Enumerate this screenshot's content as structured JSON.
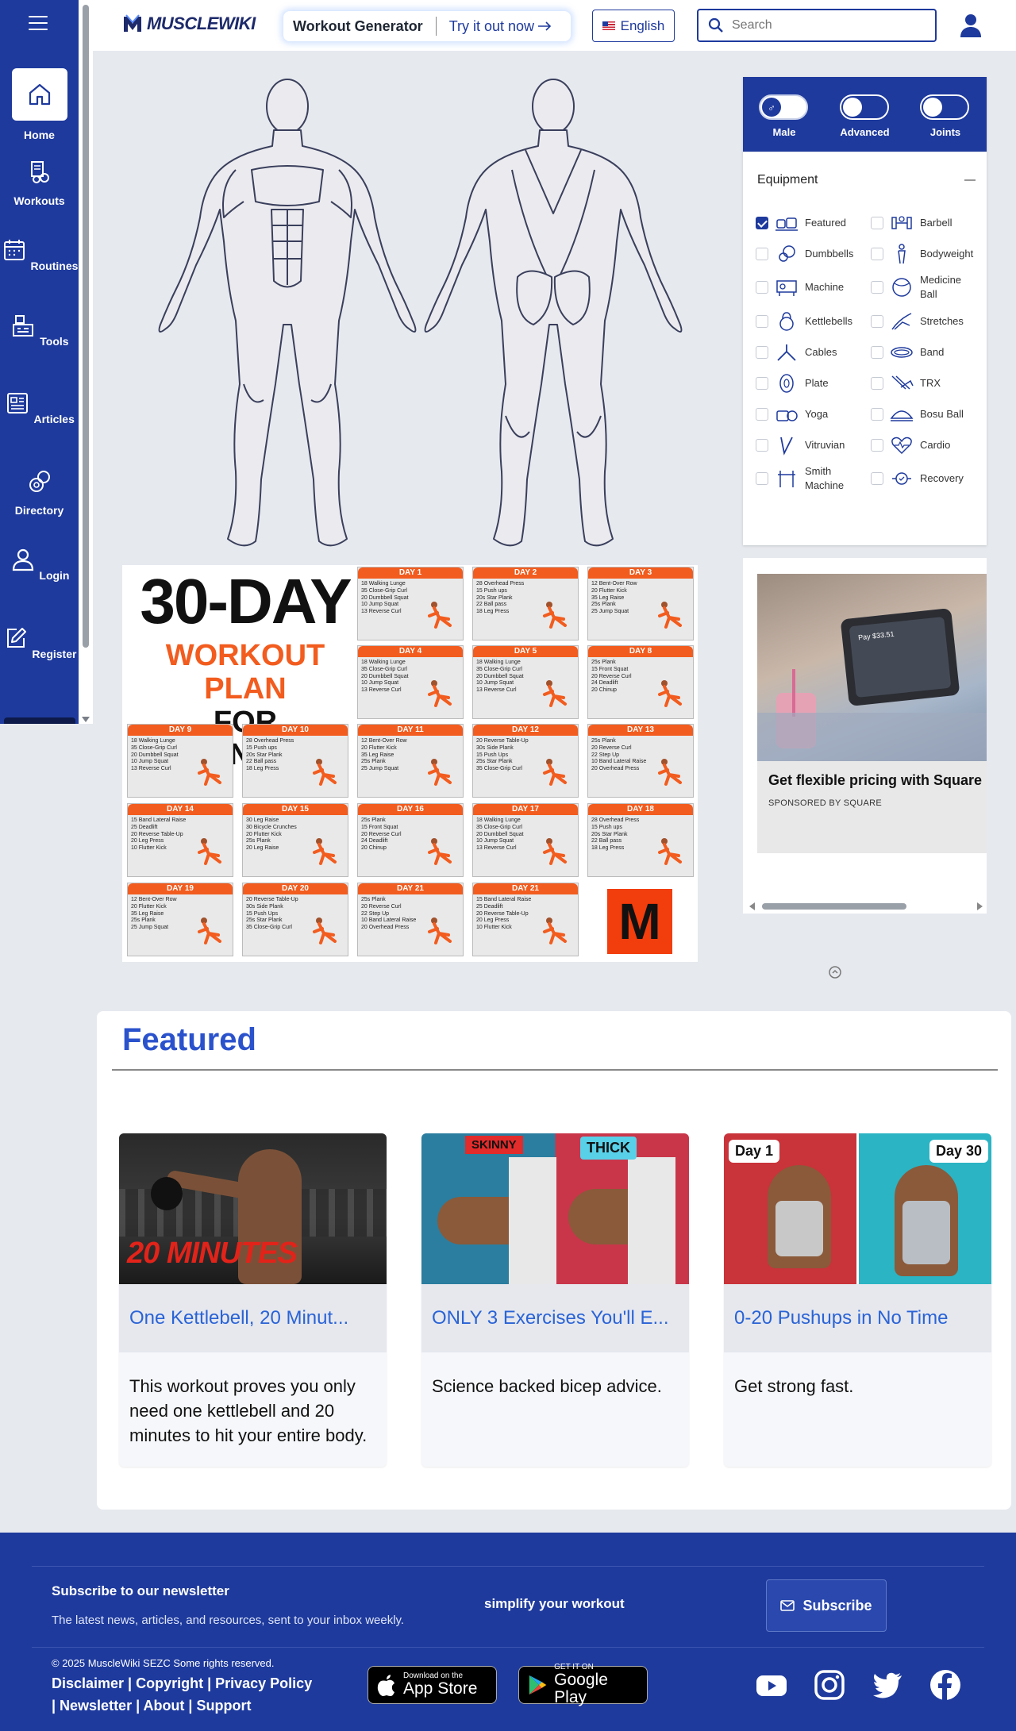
{
  "brand": {
    "name": "MUSCLEWIKI"
  },
  "sidebar": {
    "items": [
      {
        "label": "Home",
        "icon": "home-icon",
        "active": true
      },
      {
        "label": "Workouts",
        "icon": "workouts-icon"
      },
      {
        "label": "Routines",
        "icon": "calendar-icon"
      },
      {
        "label": "Tools",
        "icon": "tools-icon"
      },
      {
        "label": "Articles",
        "icon": "articles-icon"
      },
      {
        "label": "Directory",
        "icon": "directory-icon"
      },
      {
        "label": "Login",
        "icon": "user-icon"
      },
      {
        "label": "Register",
        "icon": "edit-icon"
      }
    ]
  },
  "header": {
    "workout_generator": "Workout Generator",
    "try_it": "Try it out now",
    "language": "English",
    "search_placeholder": "Search"
  },
  "filters": {
    "toggles": [
      {
        "label": "Male"
      },
      {
        "label": "Advanced"
      },
      {
        "label": "Joints"
      }
    ],
    "equipment_title": "Equipment",
    "equipment": [
      {
        "label": "Featured",
        "checked": true
      },
      {
        "label": "Barbell"
      },
      {
        "label": "Dumbbells"
      },
      {
        "label": "Bodyweight"
      },
      {
        "label": "Machine"
      },
      {
        "label": "Medicine Ball"
      },
      {
        "label": "Kettlebells"
      },
      {
        "label": "Stretches"
      },
      {
        "label": "Cables"
      },
      {
        "label": "Band"
      },
      {
        "label": "Plate"
      },
      {
        "label": "TRX"
      },
      {
        "label": "Yoga"
      },
      {
        "label": "Bosu Ball"
      },
      {
        "label": "Vitruvian"
      },
      {
        "label": "Cardio"
      },
      {
        "label": "Smith Machine"
      },
      {
        "label": "Recovery"
      }
    ]
  },
  "ad_poster": {
    "line1": "30-DAY",
    "line2": "WORKOUT PLAN",
    "line3": "FOR BEGINNERS",
    "logo_letter": "M",
    "days": [
      {
        "label": "DAY 1",
        "items": [
          "18 Walking Lunge",
          "35 Close-Grip Curl",
          "20 Dumbbell Squat",
          "10 Jump Squat",
          "13 Reverse Curl"
        ]
      },
      {
        "label": "DAY 2",
        "items": [
          "28 Overhead Press",
          "15 Push ups",
          "20s Star Plank",
          "22 Ball pass",
          "18 Leg Press"
        ]
      },
      {
        "label": "DAY 3",
        "items": [
          "12 Bent-Over Row",
          "20 Flutter Kick",
          "35 Leg Raise",
          "25s Plank",
          "25 Jump Squat"
        ]
      },
      {
        "label": "DAY 4",
        "items": [
          "18 Walking Lunge",
          "35 Close-Grip Curl",
          "20 Dumbbell Squat",
          "10 Jump Squat",
          "13 Reverse Curl"
        ]
      },
      {
        "label": "DAY 5",
        "items": [
          "18 Walking Lunge",
          "35 Close-Grip Curl",
          "20 Dumbbell Squat",
          "10 Jump Squat",
          "13 Reverse Curl"
        ]
      },
      {
        "label": "DAY 8",
        "items": [
          "25s Plank",
          "15 Front Squat",
          "20 Reverse Curl",
          "24 Deadlift",
          "20 Chinup"
        ]
      },
      {
        "label": "DAY 9",
        "items": [
          "18 Walking Lunge",
          "35 Close-Grip Curl",
          "20 Dumbbell Squat",
          "10 Jump Squat",
          "13 Reverse Curl"
        ]
      },
      {
        "label": "DAY 10",
        "items": [
          "28 Overhead Press",
          "15 Push ups",
          "20s Star Plank",
          "22 Ball pass",
          "18 Leg Press"
        ]
      },
      {
        "label": "DAY 11",
        "items": [
          "12 Bent-Over Row",
          "20 Flutter Kick",
          "35 Leg Raise",
          "25s Plank",
          "25 Jump Squat"
        ]
      },
      {
        "label": "DAY 12",
        "items": [
          "20 Reverse Table-Up",
          "30s Side Plank",
          "15 Push Ups",
          "25s Star Plank",
          "35 Close-Grip Curl"
        ]
      },
      {
        "label": "DAY 13",
        "items": [
          "25s Plank",
          "20 Reverse Curl",
          "22 Step Up",
          "10 Band Lateral Raise",
          "20 Overhead Press"
        ]
      },
      {
        "label": "DAY 14",
        "items": [
          "15 Band Lateral Raise",
          "25 Deadlift",
          "20 Reverse Table-Up",
          "20 Leg Press",
          "10 Flutter Kick"
        ]
      },
      {
        "label": "DAY 15",
        "items": [
          "30 Leg Raise",
          "30 Bicycle Crunches",
          "20 Flutter Kick",
          "25s Plank",
          "20 Leg Raise"
        ]
      },
      {
        "label": "DAY 16",
        "items": [
          "25s Plank",
          "15 Front Squat",
          "20 Reverse Curl",
          "24 Deadlift",
          "20 Chinup"
        ]
      },
      {
        "label": "DAY 17",
        "items": [
          "18 Walking Lunge",
          "35 Close-Grip Curl",
          "20 Dumbbell Squat",
          "10 Jump Squat",
          "13 Reverse Curl"
        ]
      },
      {
        "label": "DAY 18",
        "items": [
          "28 Overhead Press",
          "15 Push ups",
          "20s Star Plank",
          "22 Ball pass",
          "18 Leg Press"
        ]
      },
      {
        "label": "DAY 19",
        "items": [
          "12 Bent-Over Row",
          "20 Flutter Kick",
          "35 Leg Raise",
          "25s Plank",
          "25 Jump Squat"
        ]
      },
      {
        "label": "DAY 20",
        "items": [
          "20 Reverse Table-Up",
          "30s Side Plank",
          "15 Push Ups",
          "25s Star Plank",
          "35 Close-Grip Curl"
        ]
      },
      {
        "label": "DAY 21",
        "items": [
          "25s Plank",
          "20 Reverse Curl",
          "22 Step Up",
          "10 Band Lateral Raise",
          "20 Overhead Press"
        ]
      },
      {
        "label": "DAY 21",
        "items": [
          "15 Band Lateral Raise",
          "25 Deadlift",
          "20 Reverse Table-Up",
          "20 Leg Press",
          "10 Flutter Kick"
        ]
      }
    ]
  },
  "ad_square": {
    "headline": "Get flexible pricing with Square",
    "sponsor": "SPONSORED BY SQUARE",
    "price_tag": "Pay $33.51"
  },
  "featured": {
    "title": "Featured",
    "cards": [
      {
        "title": "One Kettlebell, 20 Minut...",
        "desc": "This workout proves you only need one kettlebell and 20 minutes to hit your entire body.",
        "overlay": "20 MINUTES"
      },
      {
        "title": "ONLY 3 Exercises You'll E...",
        "desc": "Science backed bicep advice.",
        "tag_left": "SKINNY",
        "tag_right": "THICK"
      },
      {
        "title": "0-20 Pushups in No Time",
        "desc": "Get strong fast.",
        "tag_left": "Day 1",
        "tag_right": "Day 30"
      }
    ]
  },
  "footer": {
    "newsletter_title": "Subscribe to our newsletter",
    "newsletter_sub": "The latest news, articles, and resources, sent to your inbox weekly.",
    "tagline": "simplify your workout",
    "subscribe": "Subscribe",
    "copyright": "© 2025 MuscleWiki SEZC Some rights reserved.",
    "links_row1": "Disclaimer | Copyright | Privacy Policy",
    "links_row2": "| Newsletter | About | Support",
    "app_store": {
      "small": "Download on the",
      "big": "App Store"
    },
    "google_play": {
      "small": "GET IT ON",
      "big": "Google Play"
    }
  },
  "colors": {
    "brand_blue": "#1e3a9d",
    "featured_blue": "#2a52cc",
    "poster_orange": "#f25c1e"
  }
}
